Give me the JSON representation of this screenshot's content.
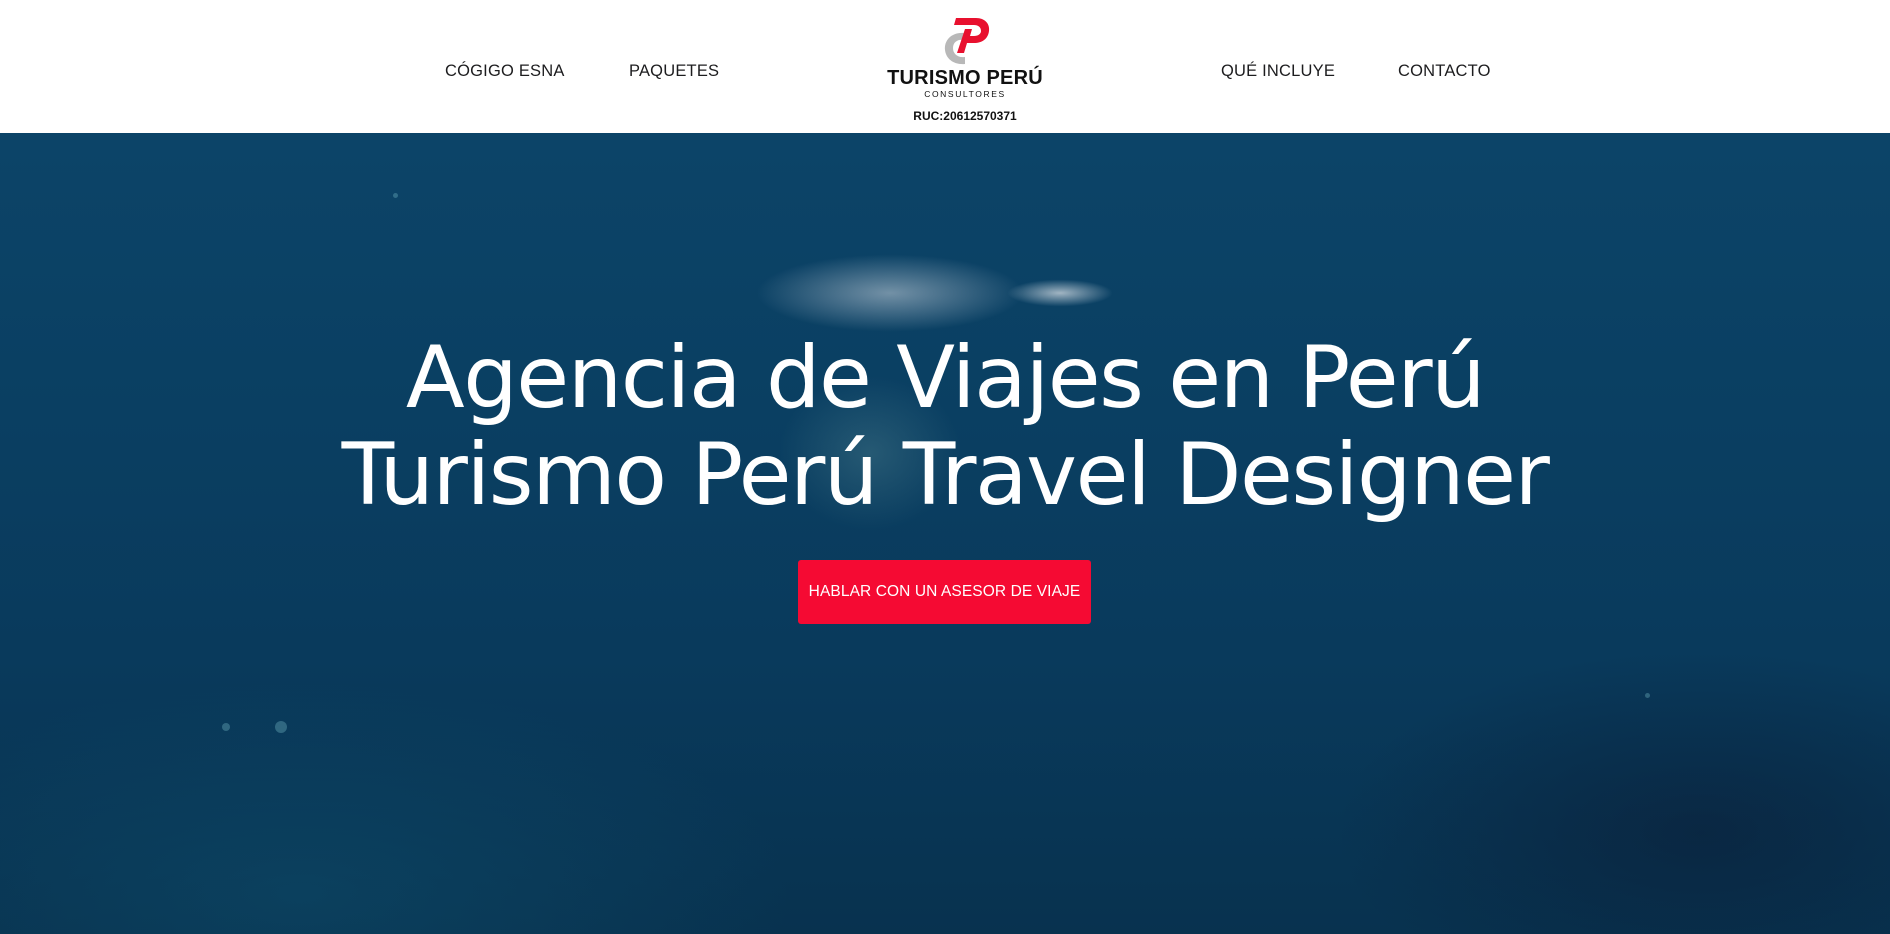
{
  "nav": {
    "left": [
      {
        "label": "CÓGIGO ESNA"
      },
      {
        "label": "PAQUETES"
      }
    ],
    "right": [
      {
        "label": "QUÉ INCLUYE"
      },
      {
        "label": "CONTACTO"
      }
    ]
  },
  "logo": {
    "name": "TURISMO PERÚ",
    "subtitle": "CONSULTORES",
    "ruc": "RUC:20612570371",
    "colors": {
      "accent": "#e8102e",
      "secondary": "#b8b8b8"
    }
  },
  "hero": {
    "headline_line1": "Agencia de Viajes en Perú",
    "headline_line2": "Turismo Perú Travel Designer",
    "cta_label": "HABLAR CON UN ASESOR DE VIAJE",
    "cta_color": "#f50a33",
    "background": "underwater-penguin-video"
  }
}
